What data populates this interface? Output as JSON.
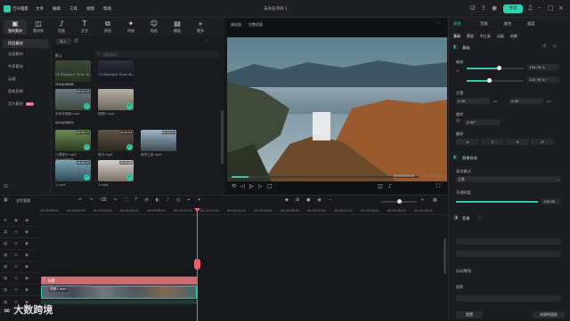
{
  "titlebar": {
    "app_name": "万兴喵影",
    "menus": [
      "文件",
      "编辑",
      "工具",
      "视图",
      "帮助"
    ],
    "project_title": "未命名项目 1",
    "export_label": "导出",
    "colors": {
      "accent": "#33c8a6",
      "export": "#2fd1b0"
    }
  },
  "toolbar": {
    "items": [
      {
        "label": "我的素材",
        "icon": "media-icon"
      },
      {
        "label": "素材库",
        "icon": "stock-icon"
      },
      {
        "label": "音频",
        "icon": "audio-icon"
      },
      {
        "label": "文字",
        "icon": "text-icon"
      },
      {
        "label": "转场",
        "icon": "transition-icon"
      },
      {
        "label": "特效",
        "icon": "effects-icon"
      },
      {
        "label": "贴纸",
        "icon": "sticker-icon"
      },
      {
        "label": "模板",
        "icon": "template-icon"
      },
      {
        "label": "更多",
        "icon": "more-icon"
      }
    ]
  },
  "sidebar": {
    "items": [
      {
        "label": "项目素材",
        "active": true
      },
      {
        "label": "全部素材",
        "active": false
      },
      {
        "label": "共享素材",
        "active": false
      },
      {
        "label": "云端",
        "active": false
      },
      {
        "label": "智能剪辑",
        "active": false
      },
      {
        "label": "官方素材",
        "active": false,
        "badge": "NEW"
      }
    ]
  },
  "media": {
    "import_label": "导入",
    "search_placeholder": "搜索素材",
    "sort_label": "默认",
    "group1_date": "2024/08/06",
    "group2_date": "2024/08/03",
    "group3_date": "2024/08/02",
    "items": [
      {
        "caption": "CS Playback Timer W...",
        "duration": ""
      },
      {
        "caption": "CS Playback Timer W...",
        "duration": ""
      },
      {
        "caption": "未命名视频.mp4",
        "duration": "00:00:12"
      },
      {
        "caption": "视频1.mp4",
        "duration": ""
      },
      {
        "caption": "江湖旅行.mp4",
        "duration": "00:00:17"
      },
      {
        "caption": "旅行.mp4",
        "duration": "00:00:09"
      },
      {
        "caption": "城市之旅.mp4",
        "duration": "00:00:07"
      },
      {
        "caption": "1.mp4",
        "duration": "00:00:11"
      },
      {
        "caption": "1.mp4",
        "duration": "00:00:08"
      }
    ]
  },
  "viewer": {
    "mode_label": "播放器",
    "quality_label": "完整质量",
    "current_time": "00:00:05:02",
    "total_time": "00:00:10:00",
    "progress": 0.09
  },
  "inspector": {
    "tabs": [
      "视频",
      "音频",
      "颜色",
      "速度"
    ],
    "subtabs": [
      "基础",
      "蒙版",
      "AI工具",
      "动画",
      "结果"
    ],
    "section_basic": "基础",
    "scale_label": "缩放",
    "scale_value_x": "135.76 %",
    "scale_value_y": "135.76 %",
    "position_label": "位置",
    "pos_x": "0.00",
    "pos_y": "0.00",
    "pos_unit_x": "px",
    "pos_unit_y": "px",
    "rotate_label": "旋转",
    "rotate_value": "0.00°",
    "flip_label": "翻转",
    "compositing_label": "图像合成",
    "blend_label": "混合模式",
    "blend_value": "正常",
    "opacity_label": "不透明度",
    "opacity_value": "100.00",
    "opacity_level": 1.0,
    "background_label": "背景",
    "auto_enhance_label": "自动增强",
    "drop_shadow_label": "投影",
    "reset_label": "重置",
    "keyframe_label": "关键帧面板"
  },
  "timeline": {
    "label": "文件管理",
    "ruler": [
      "00:00:00:00",
      "00:00:02:00",
      "00:00:04:00",
      "00:00:06:00",
      "00:00:08:00",
      "00:00:10:00",
      "00:00:12:00",
      "00:00:14:00",
      "00:00:16:00",
      "00:00:18:00",
      "00:00:20:00",
      "00:00:22:00",
      "00:00:24:00",
      "00:00:26:00",
      "00:00:28:00",
      "00:00:30:00"
    ],
    "clip_title": "标题",
    "clip_video": "视频1.mp4",
    "track_count": 8
  },
  "watermark": "大数跨境"
}
